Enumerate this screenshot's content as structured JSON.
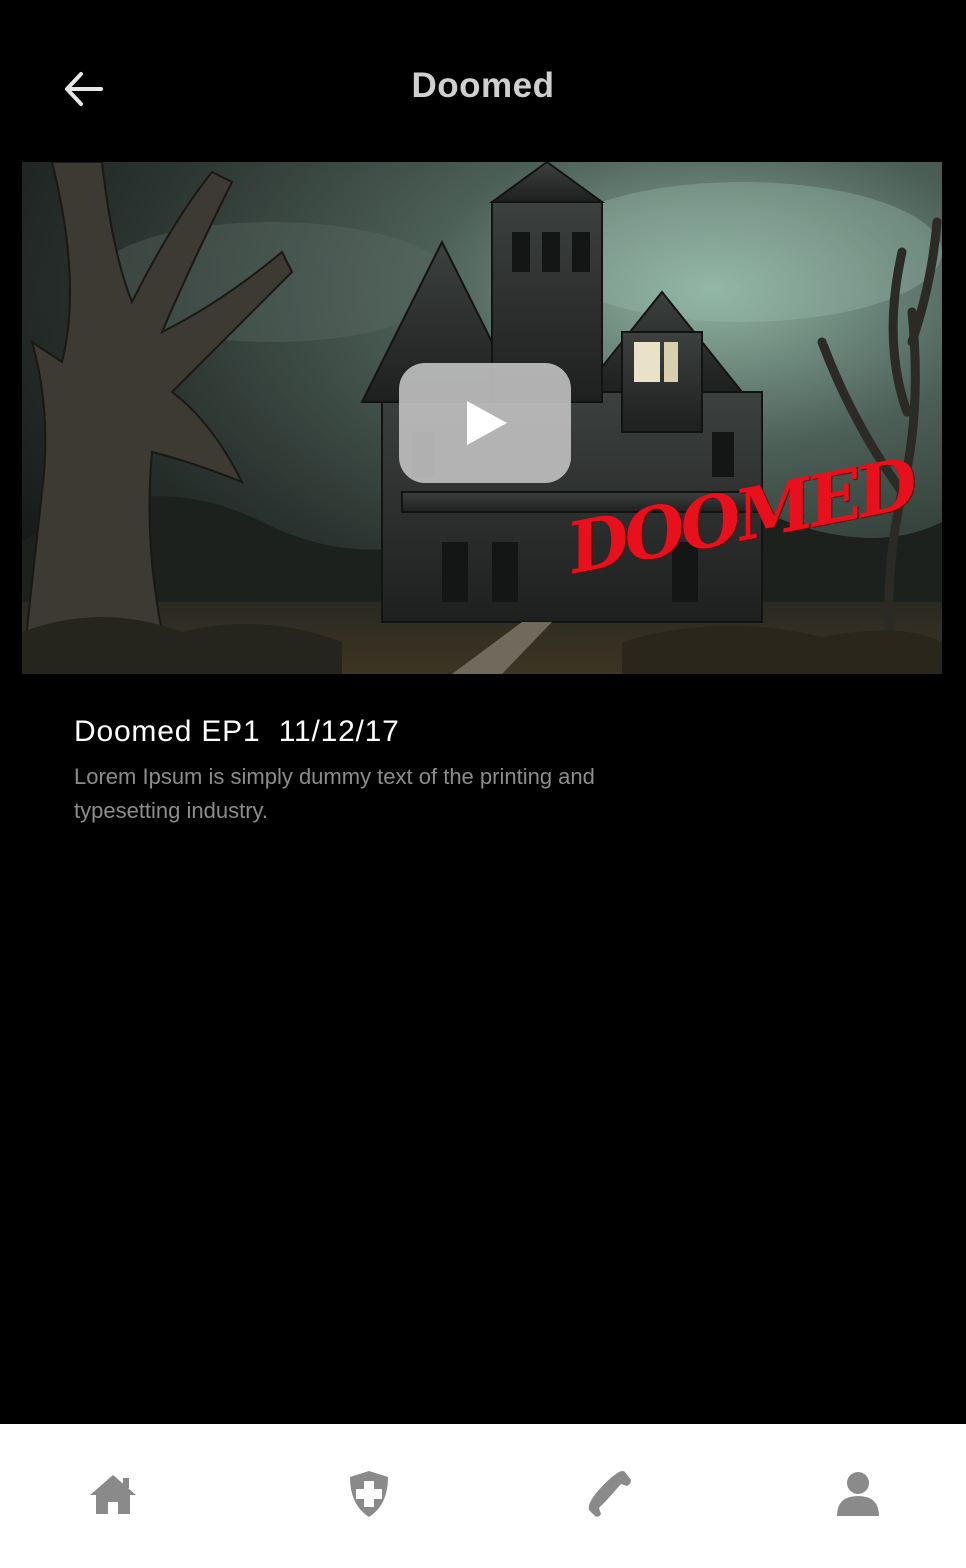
{
  "header": {
    "title": "Doomed",
    "back_icon": "arrow-left-icon"
  },
  "video": {
    "overlay_word": "DOOMED",
    "play_icon": "play-icon",
    "overlay_color": "#e8101c"
  },
  "episode": {
    "title": "Doomed EP1  11/12/17",
    "description": "Lorem Ipsum is simply dummy text of the printing and typesetting industry."
  },
  "tabbar": {
    "icon_color": "#8a8a8a",
    "items": [
      {
        "icon": "home-icon"
      },
      {
        "icon": "shield-plus-icon"
      },
      {
        "icon": "phone-icon"
      },
      {
        "icon": "user-icon"
      }
    ]
  }
}
